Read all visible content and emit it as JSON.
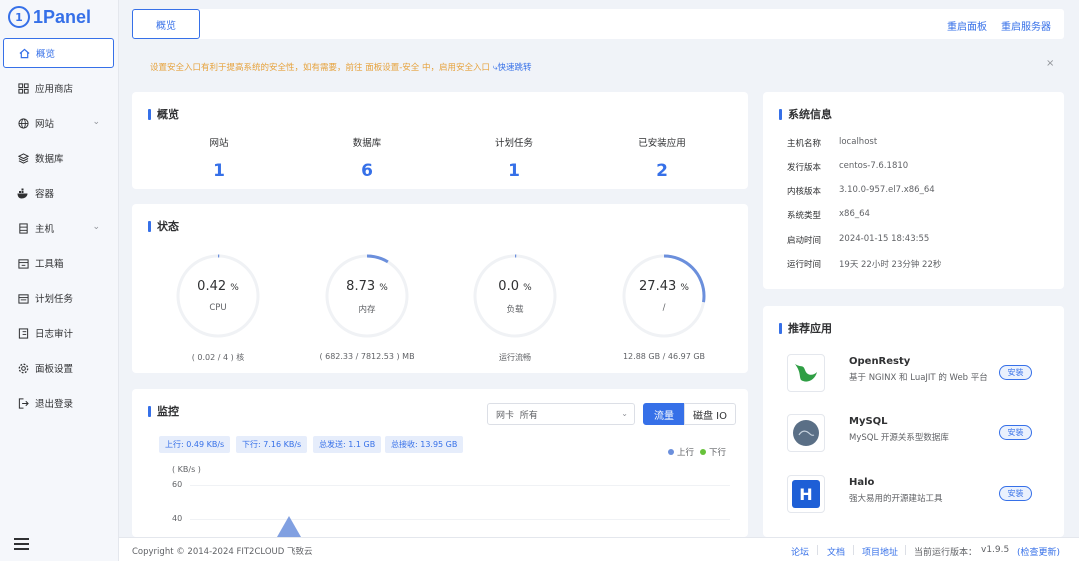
{
  "brand": {
    "name": "1Panel",
    "mark": "1",
    "accent": "#3670e8"
  },
  "sidebar": {
    "items": [
      {
        "label": "概览",
        "icon": "home-icon"
      },
      {
        "label": "应用商店",
        "icon": "app-store-icon"
      },
      {
        "label": "网站",
        "icon": "globe-icon"
      },
      {
        "label": "数据库",
        "icon": "database-icon"
      },
      {
        "label": "容器",
        "icon": "docker-icon"
      },
      {
        "label": "主机",
        "icon": "server-icon"
      },
      {
        "label": "工具箱",
        "icon": "toolbox-icon"
      },
      {
        "label": "计划任务",
        "icon": "calendar-icon"
      },
      {
        "label": "日志审计",
        "icon": "log-icon"
      },
      {
        "label": "面板设置",
        "icon": "gear-icon"
      },
      {
        "label": "退出登录",
        "icon": "logout-icon"
      }
    ]
  },
  "header": {
    "tab": "概览",
    "restart_panel": "重启面板",
    "restart_server": "重启服务器"
  },
  "notice": {
    "text": "设置安全入口有利于提高系统的安全性，如有需要，前往 面板设置-安全 中，启用安全入口",
    "link": "快速跳转",
    "close": "×"
  },
  "overview": {
    "title": "概览",
    "stats": [
      {
        "label": "网站",
        "value": "1"
      },
      {
        "label": "数据库",
        "value": "6"
      },
      {
        "label": "计划任务",
        "value": "1"
      },
      {
        "label": "已安装应用",
        "value": "2"
      }
    ]
  },
  "status": {
    "title": "状态",
    "gauges": [
      {
        "value": "0.42",
        "unit": "%",
        "name": "CPU",
        "sub": "( 0.02 / 4 ) 核",
        "percent": 0.42
      },
      {
        "value": "8.73",
        "unit": "%",
        "name": "内存",
        "sub": "( 682.33 / 7812.53 ) MB",
        "percent": 8.73
      },
      {
        "value": "0.0",
        "unit": "%",
        "name": "负载",
        "sub": "运行流畅",
        "percent": 0.0
      },
      {
        "value": "27.43",
        "unit": "%",
        "name": "/",
        "sub": "12.88 GB / 46.97 GB",
        "percent": 27.43
      }
    ]
  },
  "monitor": {
    "title": "监控",
    "nic_label": "网卡",
    "nic_value": "所有",
    "btn_traffic": "流量",
    "btn_disk": "磁盘 IO",
    "tags": [
      "上行: 0.49 KB/s",
      "下行: 7.16 KB/s",
      "总发送: 1.1 GB",
      "总接收: 13.95 GB"
    ],
    "legend_up": "上行",
    "legend_down": "下行",
    "y_unit": "( KB/s )",
    "y_ticks": [
      "60",
      "40"
    ],
    "up_color": "#6b8fdc",
    "down_color": "#67c23a"
  },
  "system": {
    "title": "系统信息",
    "rows": [
      {
        "k": "主机名称",
        "v": "localhost"
      },
      {
        "k": "发行版本",
        "v": "centos-7.6.1810"
      },
      {
        "k": "内核版本",
        "v": "3.10.0-957.el7.x86_64"
      },
      {
        "k": "系统类型",
        "v": "x86_64"
      },
      {
        "k": "启动时间",
        "v": "2024-01-15 18:43:55"
      },
      {
        "k": "运行时间",
        "v": "19天 22小时 23分钟 22秒"
      }
    ]
  },
  "apps": {
    "title": "推荐应用",
    "items": [
      {
        "name": "OpenResty",
        "desc": "基于 NGINX 和 LuaJIT 的 Web 平台",
        "btn": "安装",
        "icon": "openresty-icon"
      },
      {
        "name": "MySQL",
        "desc": "MySQL 开源关系型数据库",
        "btn": "安装",
        "icon": "mysql-icon"
      },
      {
        "name": "Halo",
        "desc": "强大易用的开源建站工具",
        "btn": "安装",
        "icon": "halo-icon",
        "letter": "H"
      }
    ]
  },
  "footer": {
    "copyright": "Copyright © 2014-2024 FIT2CLOUD 飞致云",
    "forum": "论坛",
    "docs": "文档",
    "project": "项目地址",
    "version_label": "当前运行版本：",
    "version": "v1.9.5",
    "check": "(检查更新)"
  }
}
